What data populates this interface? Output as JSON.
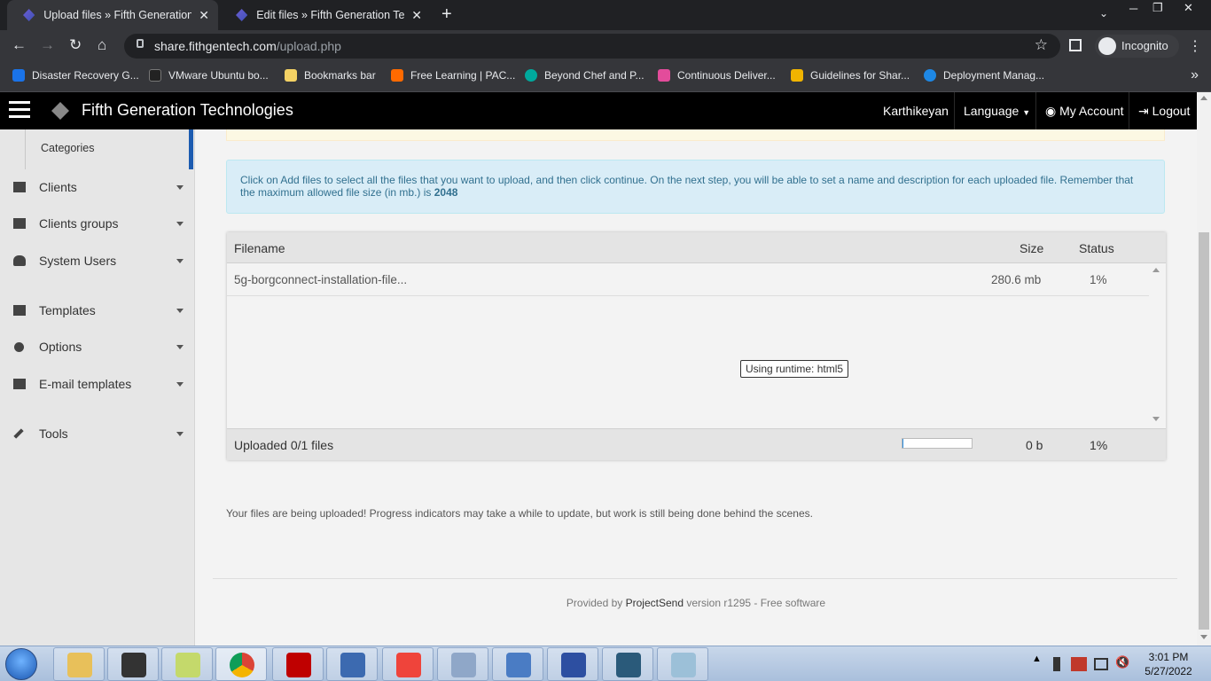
{
  "browser": {
    "tabs": [
      {
        "title": "Upload files » Fifth Generation Te",
        "active": true
      },
      {
        "title": "Edit files » Fifth Generation Techn",
        "active": false
      }
    ],
    "new_tab": "+",
    "tab_close": "✕",
    "url_host": "share.fithgentech.com",
    "url_path": "/upload.php",
    "profile_label": "Incognito",
    "window_controls": {
      "minimize": "─",
      "restore": "❐",
      "close": "✕"
    }
  },
  "bookmarks": [
    {
      "label": "Disaster Recovery G...",
      "color": "#1a73e8"
    },
    {
      "label": "VMware Ubuntu bo...",
      "color": "#222222"
    },
    {
      "label": "Bookmarks bar",
      "color": "#f4d264"
    },
    {
      "label": "Free Learning | PAC...",
      "color": "#ff6a00"
    },
    {
      "label": "Beyond Chef and P...",
      "color": "#00a99d"
    },
    {
      "label": "Continuous Deliver...",
      "color": "#e34c9b"
    },
    {
      "label": "Guidelines for Shar...",
      "color": "#f0b400"
    },
    {
      "label": "Deployment Manag...",
      "color": "#1e88e5"
    }
  ],
  "app": {
    "name": "Fifth Generation Technologies",
    "nav": {
      "user": "Karthikeyan",
      "language": "Language",
      "my_account": "My Account",
      "logout": "Logout"
    }
  },
  "sidebar": {
    "sub_item": "Categories",
    "items": [
      {
        "label": "Clients",
        "icon": "address-card-icon"
      },
      {
        "label": "Clients groups",
        "icon": "th-large-icon"
      },
      {
        "label": "System Users",
        "icon": "users-icon"
      },
      {
        "label": "Templates",
        "icon": "desktop-icon"
      },
      {
        "label": "Options",
        "icon": "cog-icon"
      },
      {
        "label": "E-mail templates",
        "icon": "envelope-icon"
      },
      {
        "label": "Tools",
        "icon": "wrench-icon"
      }
    ]
  },
  "info": {
    "text": "Click on Add files to select all the files that you want to upload, and then click continue. On the next step, you will be able to set a name and description for each uploaded file. Remember that the maximum allowed file size (in mb.) is ",
    "max_size": "2048"
  },
  "uploader": {
    "columns": {
      "filename": "Filename",
      "size": "Size",
      "status": "Status"
    },
    "files": [
      {
        "name": "5g-borgconnect-installation-file...",
        "size": "280.6 mb",
        "status": "1%"
      }
    ],
    "runtime_label": "Using runtime: html5",
    "footer": {
      "uploaded": "Uploaded 0/1 files",
      "size": "0 b",
      "status": "1%",
      "progress": 0.01
    }
  },
  "notice": "Your files are being uploaded! Progress indicators may take a while to update, but work is still being done behind the scenes.",
  "credits": {
    "prefix": "Provided by ",
    "link": "ProjectSend",
    "suffix": " version r1295 - Free software"
  },
  "taskbar": {
    "apps": [
      {
        "name": "explorer",
        "color": "#e8c05a"
      },
      {
        "name": "terminal",
        "color": "#333333"
      },
      {
        "name": "notes",
        "color": "#c4d96b"
      },
      {
        "name": "chrome",
        "color": "#db4437"
      },
      {
        "name": "filezilla",
        "color": "#bf0000"
      },
      {
        "name": "network-lock",
        "color": "#3c6ab0"
      },
      {
        "name": "anydesk",
        "color": "#ef443b"
      },
      {
        "name": "tools",
        "color": "#8fa7c8"
      },
      {
        "name": "control-panel",
        "color": "#4a7cc4"
      },
      {
        "name": "putty",
        "color": "#2d4fa1"
      },
      {
        "name": "mysql-workbench",
        "color": "#2a5a7a"
      },
      {
        "name": "notepad",
        "color": "#9cc0d8"
      }
    ],
    "time": "3:01 PM",
    "date": "5/27/2022"
  }
}
